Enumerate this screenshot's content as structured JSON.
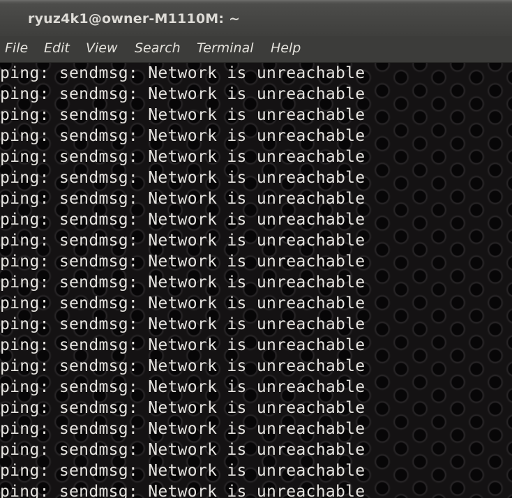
{
  "window": {
    "title": "ryuz4k1@owner-M1110M: ~"
  },
  "menubar": {
    "items": [
      {
        "label": "File"
      },
      {
        "label": "Edit"
      },
      {
        "label": "View"
      },
      {
        "label": "Search"
      },
      {
        "label": "Terminal"
      },
      {
        "label": "Help"
      }
    ]
  },
  "terminal": {
    "lines": [
      "ping: sendmsg: Network is unreachable",
      "ping: sendmsg: Network is unreachable",
      "ping: sendmsg: Network is unreachable",
      "ping: sendmsg: Network is unreachable",
      "ping: sendmsg: Network is unreachable",
      "ping: sendmsg: Network is unreachable",
      "ping: sendmsg: Network is unreachable",
      "ping: sendmsg: Network is unreachable",
      "ping: sendmsg: Network is unreachable",
      "ping: sendmsg: Network is unreachable",
      "ping: sendmsg: Network is unreachable",
      "ping: sendmsg: Network is unreachable",
      "ping: sendmsg: Network is unreachable",
      "ping: sendmsg: Network is unreachable",
      "ping: sendmsg: Network is unreachable",
      "ping: sendmsg: Network is unreachable",
      "ping: sendmsg: Network is unreachable",
      "ping: sendmsg: Network is unreachable",
      "ping: sendmsg: Network is unreachable",
      "ping: sendmsg: Network is unreachable",
      "ping: sendmsg: Network is unreachable"
    ]
  }
}
